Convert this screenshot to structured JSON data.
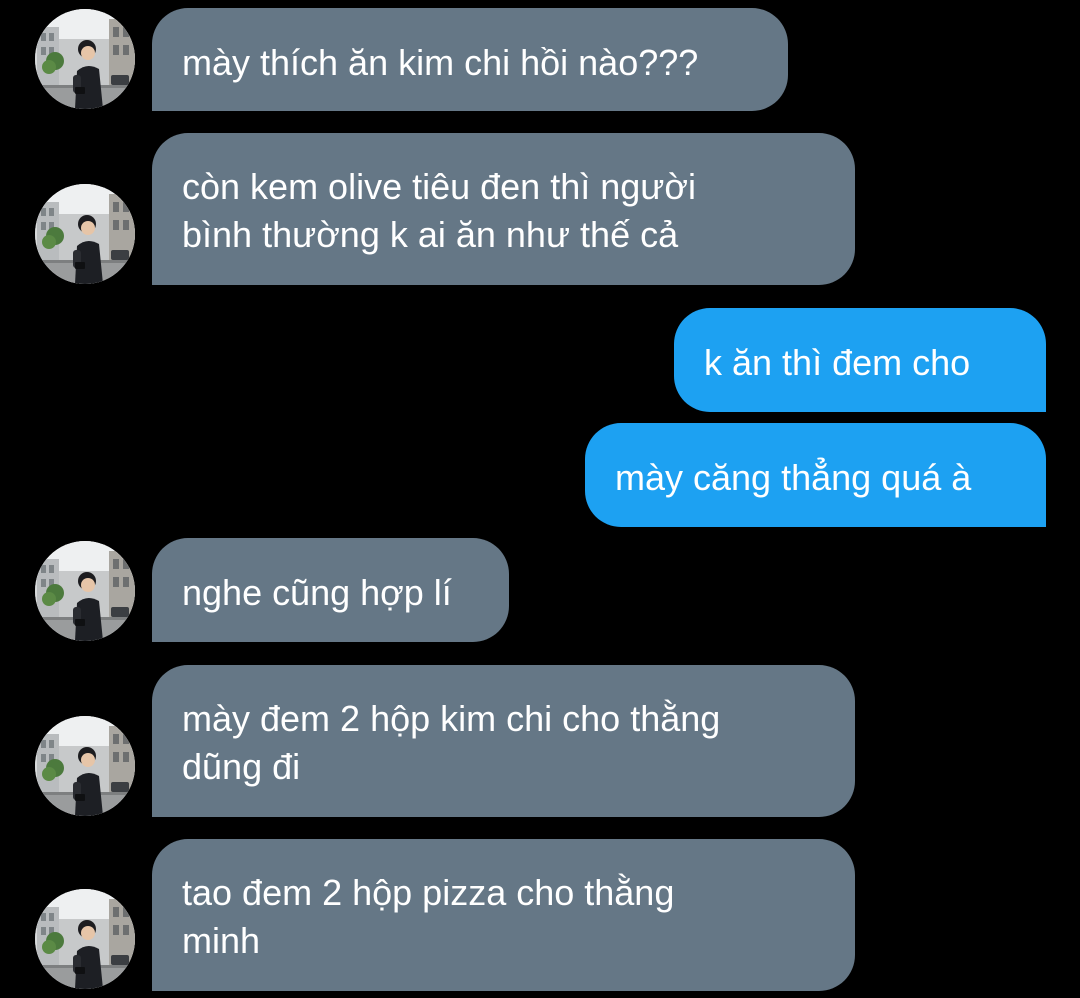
{
  "colors": {
    "background": "#000000",
    "received_bubble": "#657786",
    "sent_bubble": "#1da1f2",
    "text": "#ffffff"
  },
  "avatar_icon": "person-photo-avatar",
  "messages": [
    {
      "direction": "received",
      "lines": [
        "mày thích ăn kim chi hồi nào???"
      ]
    },
    {
      "direction": "received",
      "lines": [
        "còn kem olive tiêu đen thì người",
        "bình thường k ai ăn như thế cả"
      ]
    },
    {
      "direction": "sent",
      "lines": [
        "k ăn thì đem cho"
      ]
    },
    {
      "direction": "sent",
      "lines": [
        "mày căng thẳng quá à"
      ]
    },
    {
      "direction": "received",
      "lines": [
        "nghe cũng hợp lí"
      ]
    },
    {
      "direction": "received",
      "lines": [
        "mày đem 2 hộp kim chi cho thằng",
        "dũng đi"
      ]
    },
    {
      "direction": "received",
      "lines": [
        "tao đem 2 hộp pizza cho thằng",
        "minh"
      ]
    }
  ]
}
